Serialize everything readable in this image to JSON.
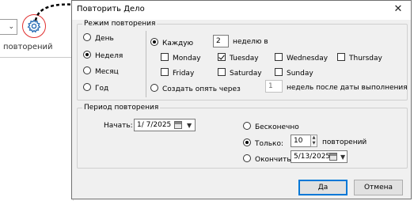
{
  "background": {
    "label": "повторений",
    "icons": [
      "gear-icon",
      "chevron-down-icon"
    ],
    "highlight_color": "#e03030"
  },
  "dialog": {
    "title": "Повторить Дело",
    "close_label": "✕",
    "repeat_mode": {
      "legend": "Режим повторения",
      "periods": [
        {
          "label": "День",
          "selected": false
        },
        {
          "label": "Неделя",
          "selected": true
        },
        {
          "label": "Месяц",
          "selected": false
        },
        {
          "label": "Год",
          "selected": false
        }
      ],
      "every_label": "Каждую",
      "every_value": "2",
      "every_unit": "неделю в",
      "days": [
        {
          "label": "Monday",
          "checked": false
        },
        {
          "label": "Tuesday",
          "checked": true
        },
        {
          "label": "Wednesday",
          "checked": false
        },
        {
          "label": "Thursday",
          "checked": false
        },
        {
          "label": "Friday",
          "checked": false
        },
        {
          "label": "Saturday",
          "checked": false
        },
        {
          "label": "Sunday",
          "checked": false
        }
      ],
      "regenerate_label": "Создать опять через",
      "regenerate_value": "1",
      "regenerate_suffix": "недель после даты выполнения"
    },
    "repeat_period": {
      "legend": "Период повторения",
      "start_label": "Начать:",
      "start_date": "1/  7/2025",
      "infinite_label": "Бесконечно",
      "only_label": "Только:",
      "only_value": "10",
      "only_suffix": "повторений",
      "end_label": "Окончить:",
      "end_date": "5/13/2025",
      "selected": "only"
    },
    "ok_label": "Да",
    "cancel_label": "Отмена",
    "accent_color": "#0078d7"
  }
}
